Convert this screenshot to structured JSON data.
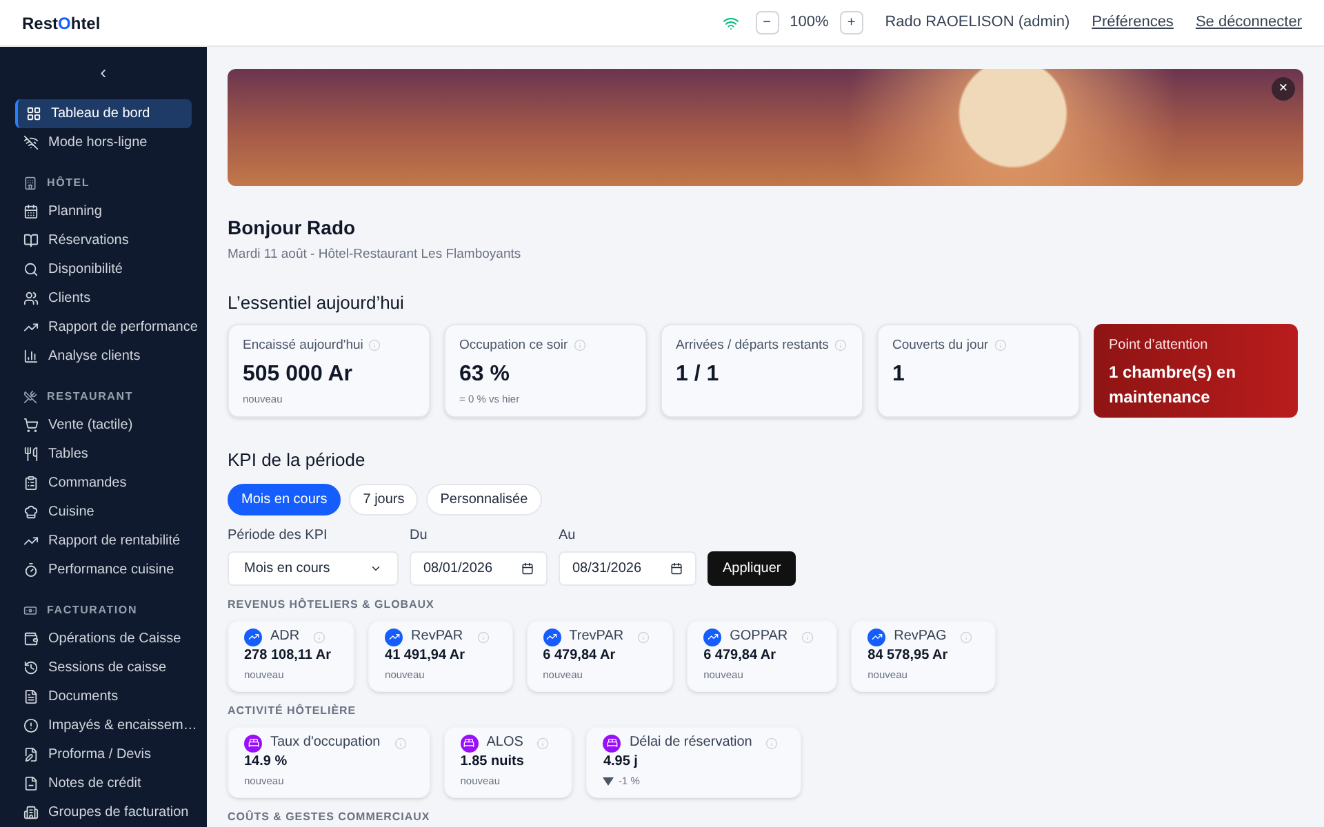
{
  "header": {
    "logo": {
      "before": "Rest",
      "accent": "O",
      "after": "htel"
    },
    "online": true,
    "zoom_out": "−",
    "zoom": "100%",
    "zoom_in": "+",
    "user": "Rado RAOELISON (admin)",
    "links": [
      "Préférences",
      "Se déconnecter"
    ]
  },
  "sidebar": {
    "collapse": "‹",
    "items": [
      {
        "kind": "item",
        "label": "Tableau de bord",
        "selected": true
      },
      {
        "kind": "item",
        "label": "Mode hors-ligne",
        "selected": false
      },
      {
        "kind": "section",
        "label": "HÔTEL"
      },
      {
        "kind": "item",
        "label": "Planning",
        "selected": false
      },
      {
        "kind": "item",
        "label": "Réservations",
        "selected": false
      },
      {
        "kind": "item",
        "label": "Disponibilité",
        "selected": false
      },
      {
        "kind": "item",
        "label": "Clients",
        "selected": false
      },
      {
        "kind": "item",
        "label": "Rapport de performance",
        "selected": false
      },
      {
        "kind": "item",
        "label": "Analyse clients",
        "selected": false
      },
      {
        "kind": "section",
        "label": "RESTAURANT"
      },
      {
        "kind": "item",
        "label": "Vente (tactile)",
        "selected": false
      },
      {
        "kind": "item",
        "label": "Tables",
        "selected": false
      },
      {
        "kind": "item",
        "label": "Commandes",
        "selected": false
      },
      {
        "kind": "item",
        "label": "Cuisine",
        "selected": false
      },
      {
        "kind": "item",
        "label": "Rapport de rentabilité",
        "selected": false
      },
      {
        "kind": "item",
        "label": "Performance cuisine",
        "selected": false
      },
      {
        "kind": "section",
        "label": "FACTURATION"
      },
      {
        "kind": "item",
        "label": "Opérations de Caisse",
        "selected": false
      },
      {
        "kind": "item",
        "label": "Sessions de caisse",
        "selected": false
      },
      {
        "kind": "item",
        "label": "Documents",
        "selected": false
      },
      {
        "kind": "item",
        "label": "Impayés & encaissem…",
        "selected": false
      },
      {
        "kind": "item",
        "label": "Proforma / Devis",
        "selected": false
      },
      {
        "kind": "item",
        "label": "Notes de crédit",
        "selected": false
      },
      {
        "kind": "item",
        "label": "Groupes de facturation",
        "selected": false
      }
    ]
  },
  "banner": {
    "close": "×"
  },
  "greeting": {
    "title": "Bonjour Rado",
    "subtitle": "Mardi 11 août - Hôtel-Restaurant Les Flamboyants"
  },
  "today": {
    "title": "L’essentiel aujourd’hui",
    "cards": [
      {
        "kind": "stat",
        "label": "Encaissé aujourd'hui",
        "value": "505 000 Ar",
        "note": "nouveau"
      },
      {
        "kind": "stat",
        "label": "Occupation ce soir",
        "value": "63 %",
        "note": "= 0 % vs hier"
      },
      {
        "kind": "stat",
        "label": "Arrivées / départs restants",
        "value": "1 / 1"
      },
      {
        "kind": "stat",
        "label": "Couverts du jour",
        "value": "1"
      },
      {
        "kind": "alert",
        "label": "Point d’attention",
        "value": "1 chambre(s) en maintenance"
      }
    ]
  },
  "kpi": {
    "title": "KPI de la période",
    "tabs": [
      {
        "label": "Mois en cours",
        "selected": true
      },
      {
        "label": "7 jours",
        "selected": false
      },
      {
        "label": "Personnalisée",
        "selected": false
      }
    ],
    "period": {
      "label": "Période des KPI",
      "value": "Mois en cours"
    },
    "from": {
      "label": "Du",
      "value": "08/01/2026"
    },
    "to": {
      "label": "Au",
      "value": "08/31/2026"
    },
    "apply": "Appliquer",
    "groups": [
      {
        "kind": "revenue",
        "title": "REVENUS HÔTELIERS & GLOBAUX",
        "cards": [
          {
            "label": "ADR",
            "value": "278 108,11 Ar",
            "note": "nouveau"
          },
          {
            "label": "RevPAR",
            "value": "41 491,94 Ar",
            "note": "nouveau"
          },
          {
            "label": "TrevPAR",
            "value": "6 479,84 Ar",
            "note": "nouveau"
          },
          {
            "label": "GOPPAR",
            "value": "6 479,84 Ar",
            "note": "nouveau"
          },
          {
            "label": "RevPAG",
            "value": "84 578,95 Ar",
            "note": "nouveau"
          }
        ]
      },
      {
        "kind": "activity",
        "title": "ACTIVITÉ HÔTELIÈRE",
        "cards": [
          {
            "label": "Taux d'occupation",
            "value": "14.9 %",
            "note": "nouveau"
          },
          {
            "label": "ALOS",
            "value": "1.85 nuits",
            "note": "nouveau"
          },
          {
            "label": "Délai de réservation",
            "value": "4.95 j",
            "falling": true,
            "note": "-1 %"
          }
        ]
      },
      {
        "kind": "costs",
        "title": "COÛTS & GESTES COMMERCIAUX"
      }
    ]
  }
}
